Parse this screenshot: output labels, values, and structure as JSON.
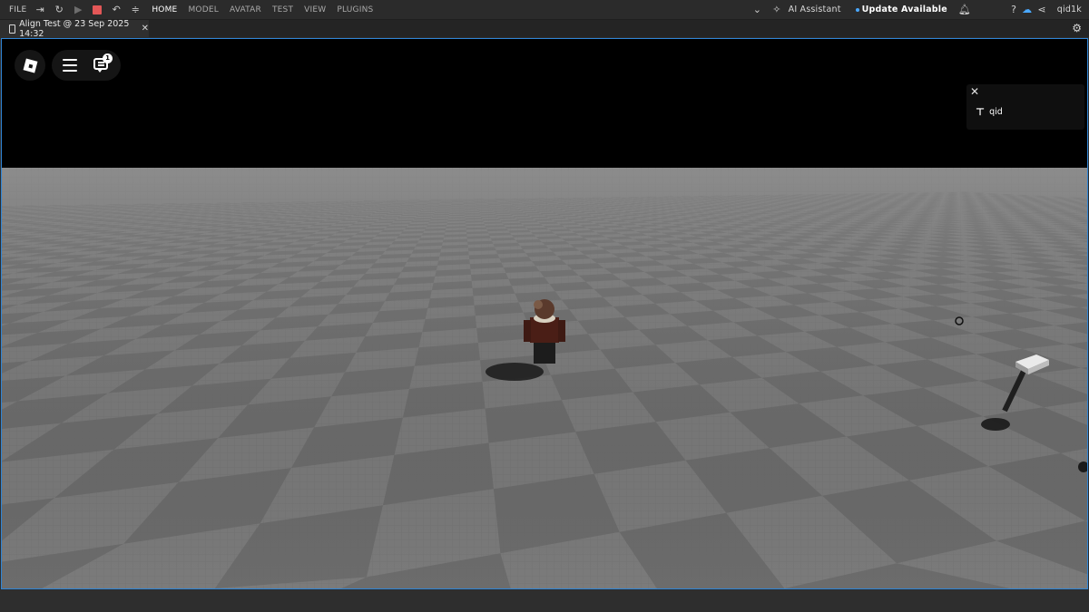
{
  "menubar": {
    "file_label": "FILE",
    "tabs": [
      {
        "label": "HOME",
        "active": true
      },
      {
        "label": "MODEL",
        "active": false
      },
      {
        "label": "AVATAR",
        "active": false
      },
      {
        "label": "TEST",
        "active": false
      },
      {
        "label": "VIEW",
        "active": false
      },
      {
        "label": "PLUGINS",
        "active": false
      }
    ],
    "ai_assistant_label": "AI Assistant",
    "update_label": "Update Available",
    "username": "qid1k"
  },
  "document_tab": {
    "title": "Align Test @ 23 Sep 2025 14:32"
  },
  "viewport": {
    "chat_badge_count": "1",
    "tool_panel": {
      "tool_name": "qid"
    }
  },
  "colors": {
    "accent_border": "#2f85d6",
    "stop_button": "#e35757",
    "update_dot": "#4aa8ff",
    "sky": "#000000",
    "baseplate": "#7b7b7b"
  }
}
